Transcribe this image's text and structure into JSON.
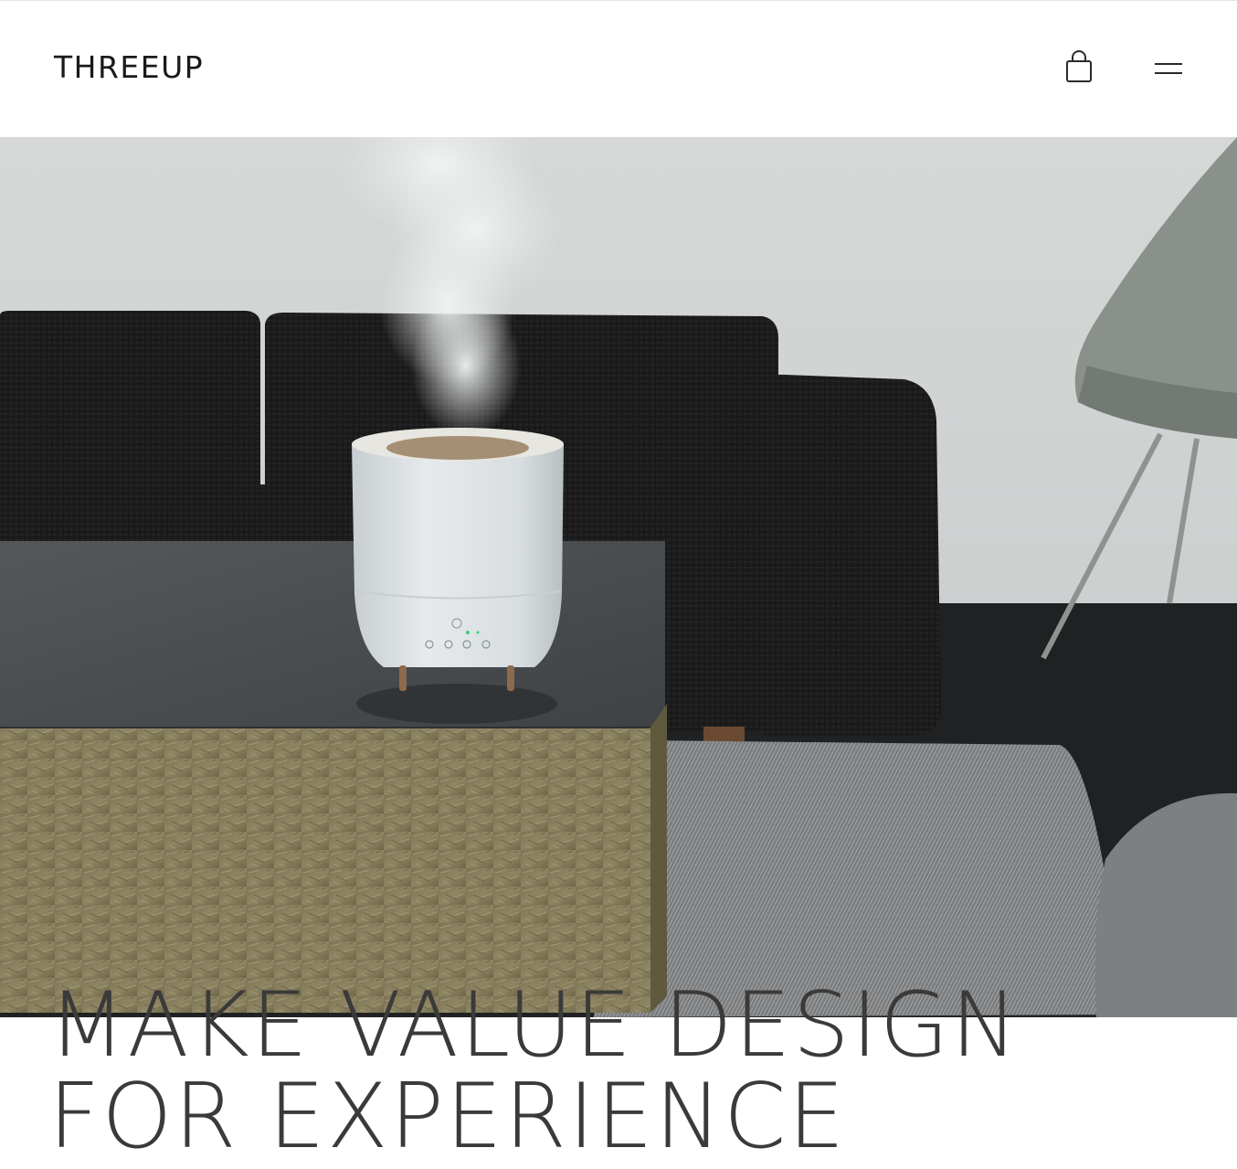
{
  "header": {
    "logo": "THREEUP",
    "cart_icon": "shopping-bag-icon",
    "menu_icon": "hamburger-menu-icon"
  },
  "hero": {
    "image_subject": "white humidifier with mist on a stone coffee table in front of a black sofa",
    "headline_line1": "MAKE VALUE DESIGN",
    "headline_line2": "FOR EXPERIENCE"
  },
  "colors": {
    "text": "#1a1a1a",
    "headline": "#3a3a3a",
    "background": "#ffffff"
  }
}
